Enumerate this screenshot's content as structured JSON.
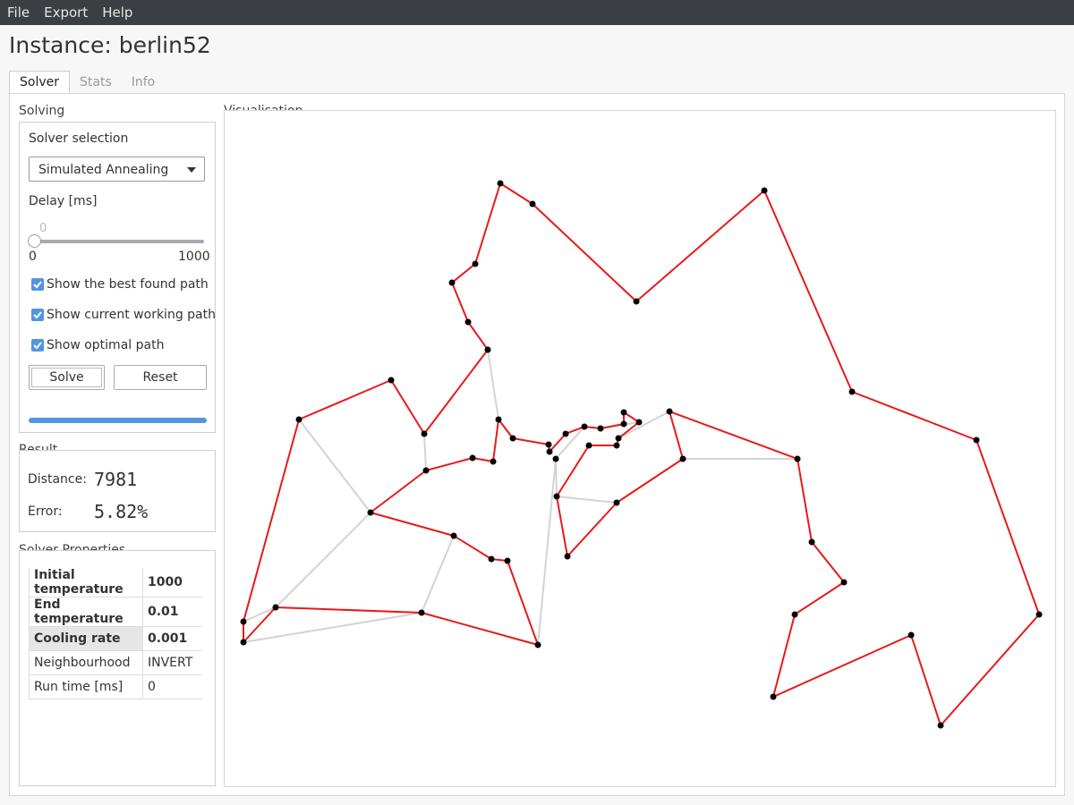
{
  "menu": [
    "File",
    "Export",
    "Help"
  ],
  "title": "Instance: berlin52",
  "tabs": [
    "Solver",
    "Stats",
    "Info"
  ],
  "solving": {
    "group_title": "Solving",
    "solver_label": "Solver selection",
    "solver_value": "Simulated Annealing",
    "delay_label": "Delay [ms]",
    "delay_value": "0",
    "delay_min": "0",
    "delay_max": "1000",
    "checkboxes": [
      {
        "label": "Show the best found path",
        "checked": true
      },
      {
        "label": "Show current working path",
        "checked": true
      },
      {
        "label": "Show optimal path",
        "checked": true
      }
    ],
    "solve_button": "Solve",
    "reset_button": "Reset",
    "progress": 1.0
  },
  "result": {
    "group_title": "Result",
    "distance_label": "Distance:",
    "distance_value": "7981",
    "error_label": "Error:",
    "error_value": "5.82%"
  },
  "properties": {
    "group_title": "Solver Properties",
    "rows": [
      {
        "key": "Initial temperature",
        "value": "1000"
      },
      {
        "key": "End temperature",
        "value": "0.01"
      },
      {
        "key": "Cooling rate",
        "value": "0.001"
      },
      {
        "key": "Neighbourhood",
        "value": "INVERT"
      },
      {
        "key": "Run time [ms]",
        "value": "0"
      }
    ]
  },
  "visualisation": {
    "group_title": "Visualisation",
    "colors": {
      "found_path": "#e8191b",
      "optimal_path": "#d3d3d3",
      "node": "#000000"
    }
  }
}
